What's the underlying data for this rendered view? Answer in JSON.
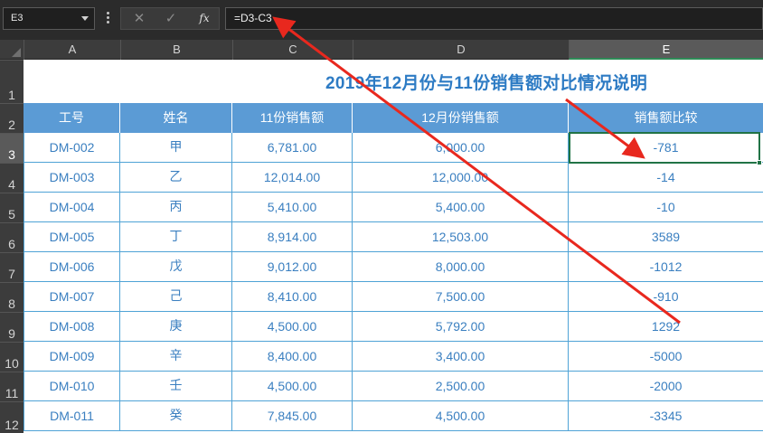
{
  "formula_bar": {
    "name_box": "E3",
    "cancel_icon": "✕",
    "enter_icon": "✓",
    "function_icon": "fx",
    "formula": "=D3-C3"
  },
  "columns": [
    "A",
    "B",
    "C",
    "D",
    "E"
  ],
  "selected_column": "E",
  "row_numbers": [
    "1",
    "2",
    "3",
    "4",
    "5",
    "6",
    "7",
    "8",
    "9",
    "10",
    "11",
    "12"
  ],
  "selected_row": "3",
  "sheet": {
    "title": "2019年12月份与11份销售额对比情况说明",
    "headers": [
      "工号",
      "姓名",
      "11份销售额",
      "12月份销售额",
      "销售额比较"
    ],
    "rows": [
      [
        "DM-002",
        "甲",
        "6,781.00",
        "6,000.00",
        "-781"
      ],
      [
        "DM-003",
        "乙",
        "12,014.00",
        "12,000.00",
        "-14"
      ],
      [
        "DM-004",
        "丙",
        "5,410.00",
        "5,400.00",
        "-10"
      ],
      [
        "DM-005",
        "丁",
        "8,914.00",
        "12,503.00",
        "3589"
      ],
      [
        "DM-006",
        "戊",
        "9,012.00",
        "8,000.00",
        "-1012"
      ],
      [
        "DM-007",
        "己",
        "8,410.00",
        "7,500.00",
        "-910"
      ],
      [
        "DM-008",
        "庚",
        "4,500.00",
        "5,792.00",
        "1292"
      ],
      [
        "DM-009",
        "辛",
        "8,400.00",
        "3,400.00",
        "-5000"
      ],
      [
        "DM-010",
        "壬",
        "4,500.00",
        "2,500.00",
        "-2000"
      ],
      [
        "DM-011",
        "癸",
        "7,845.00",
        "4,500.00",
        "-3345"
      ]
    ]
  },
  "colors": {
    "header_fill": "#5b9bd5",
    "title_text": "#2d7bc4",
    "cell_text": "#3a7fc0",
    "grid_line": "#4fa3d6",
    "active_border": "#217346",
    "annotation_arrow": "#e8281e"
  }
}
